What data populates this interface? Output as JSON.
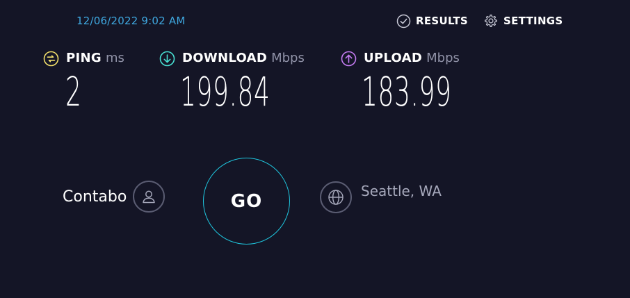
{
  "header": {
    "timestamp": "12/06/2022 9:02 AM",
    "nav": [
      {
        "label": "RESULTS",
        "icon": "check-circle-icon"
      },
      {
        "label": "SETTINGS",
        "icon": "gear-icon"
      }
    ]
  },
  "metrics": {
    "ping": {
      "label": "PING",
      "unit": "ms",
      "value": "2",
      "icon": "ping-icon",
      "icon_color": "#f3e06b"
    },
    "download": {
      "label": "DOWNLOAD",
      "unit": "Mbps",
      "value": "199.84",
      "icon": "download-arrow-icon",
      "icon_color": "#48e0d3"
    },
    "upload": {
      "label": "UPLOAD",
      "unit": "Mbps",
      "value": "183.99",
      "icon": "upload-arrow-icon",
      "icon_color": "#c57cf3"
    }
  },
  "provider": {
    "name": "Contabo",
    "icon": "user-icon"
  },
  "go_button": {
    "label": "GO",
    "ring_color": "#1fc7df"
  },
  "server": {
    "location": "Seattle, WA",
    "icon": "globe-icon"
  },
  "colors": {
    "background": "#141526",
    "timestamp": "#3fa8e0",
    "muted": "#9193a8"
  }
}
